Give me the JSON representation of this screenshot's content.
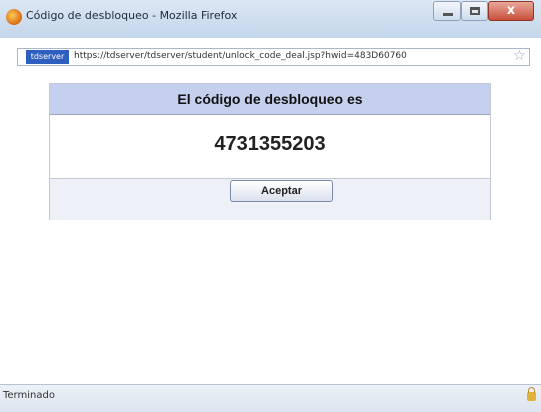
{
  "window": {
    "title": "Código de desbloqueo - Mozilla Firefox",
    "close_glyph": "x"
  },
  "address_bar": {
    "site_label": "tdserver",
    "url": "https://tdserver/tdserver/student/unlock_code_deal.jsp?hwid=483D60760"
  },
  "dialog": {
    "header": "El código de desbloqueo es",
    "code": "4731355203",
    "accept_label": "Aceptar"
  },
  "status_bar": {
    "text": "Terminado"
  },
  "colors": {
    "header_bg": "#c4d0ee",
    "footer_bg": "#eef0f8",
    "site_badge": "#2f5fbe"
  }
}
